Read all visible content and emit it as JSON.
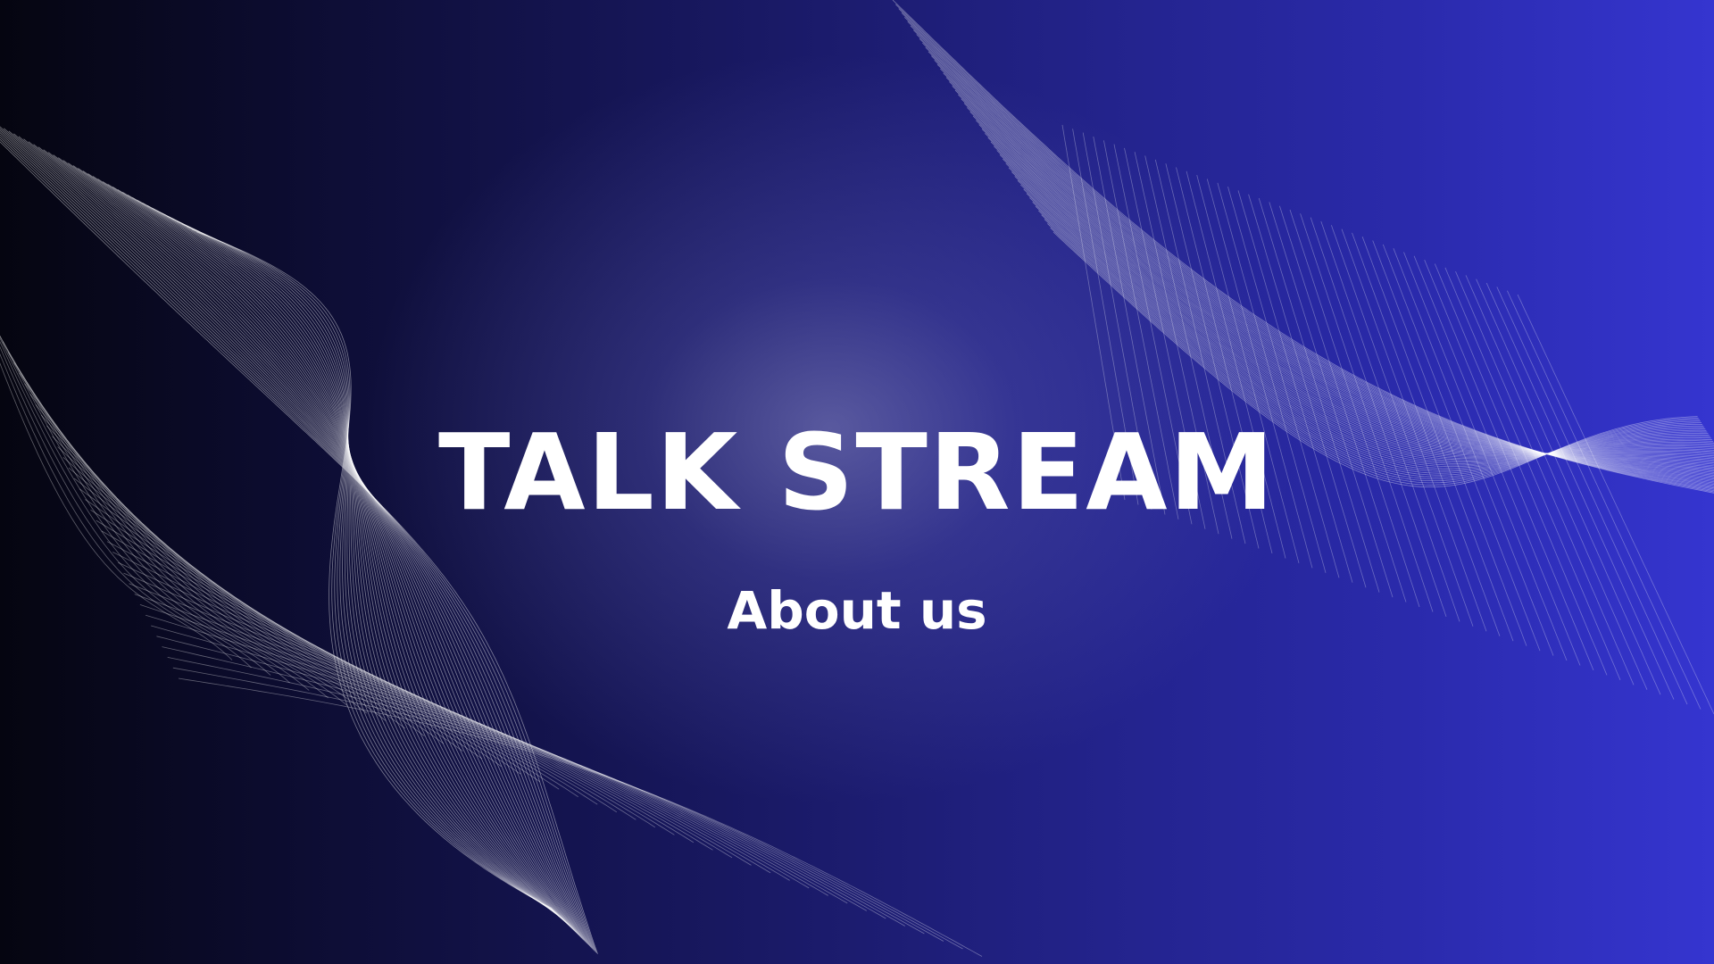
{
  "slide": {
    "title": "TALK STREAM",
    "subtitle": "About us"
  },
  "colors": {
    "background_left": "#050510",
    "background_right": "#3535d0",
    "text": "#ffffff",
    "wave_lines": "#ffffff"
  }
}
